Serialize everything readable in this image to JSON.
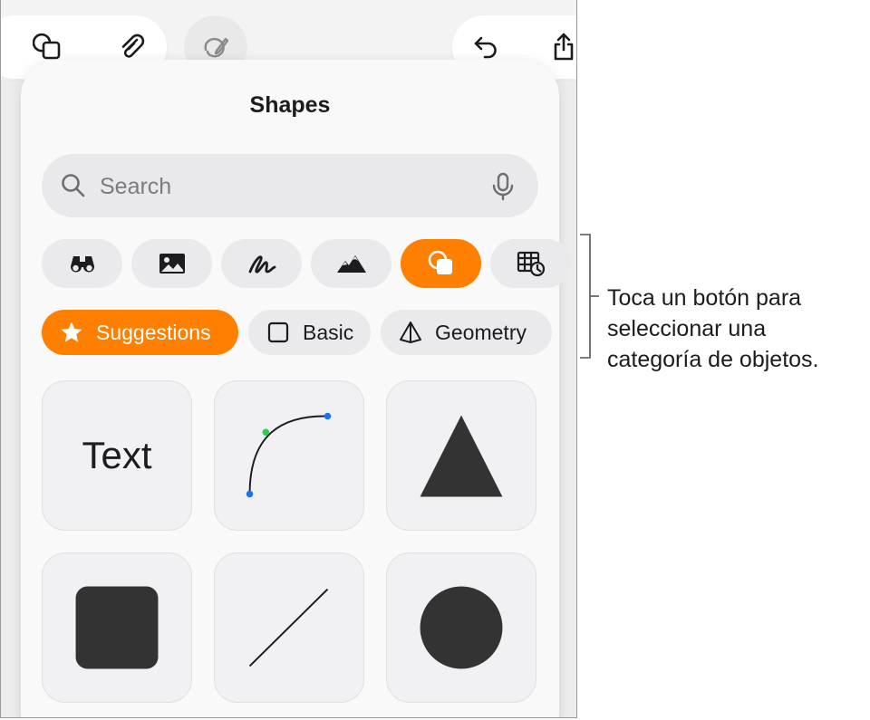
{
  "toolbar": {
    "shapes_icon": "shapes-icon",
    "attach_icon": "paperclip-icon",
    "markup_icon": "markup-pen-icon",
    "undo_icon": "undo-icon",
    "share_icon": "share-icon"
  },
  "panel": {
    "title": "Shapes",
    "search": {
      "placeholder": "Search"
    },
    "categories": [
      {
        "icon": "binoculars-icon",
        "active": false
      },
      {
        "icon": "photo-icon",
        "active": false
      },
      {
        "icon": "scribble-icon",
        "active": false
      },
      {
        "icon": "mountains-icon",
        "active": false
      },
      {
        "icon": "shapes-icon",
        "active": true
      },
      {
        "icon": "table-chart-icon",
        "active": false
      }
    ],
    "chips": [
      {
        "label": "Suggestions",
        "icon": "star-icon",
        "active": true
      },
      {
        "label": "Basic",
        "icon": "square-outline-icon",
        "active": false
      },
      {
        "label": "Geometry",
        "icon": "pyramid-icon",
        "active": false
      }
    ],
    "tiles": [
      {
        "kind": "text",
        "label": "Text"
      },
      {
        "kind": "curve"
      },
      {
        "kind": "triangle"
      },
      {
        "kind": "rounded-square"
      },
      {
        "kind": "line"
      },
      {
        "kind": "circle"
      }
    ]
  },
  "annotation": {
    "lines": [
      "Toca un botón para",
      "seleccionar una",
      "categoría de objetos."
    ]
  },
  "colors": {
    "accent": "#ff7f00",
    "shape_fill": "#333333",
    "control_point_blue": "#1a73e8",
    "control_point_green": "#34c759"
  }
}
